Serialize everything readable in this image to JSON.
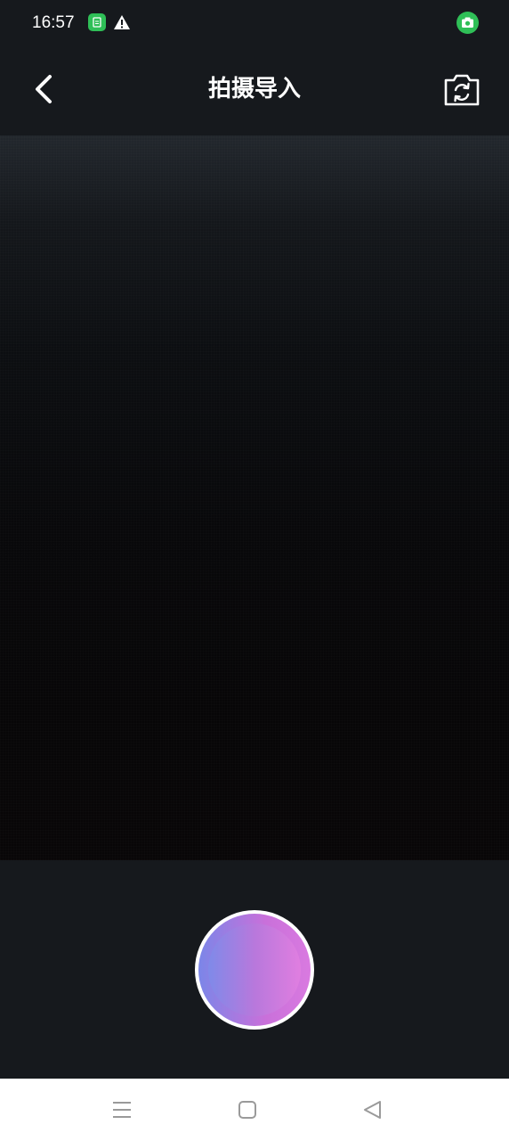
{
  "status_bar": {
    "time": "16:57",
    "icons": [
      "app-notification-icon",
      "warning-icon",
      "camera-in-use-icon"
    ]
  },
  "header": {
    "title": "拍摄导入",
    "back_icon": "chevron-left-icon",
    "switch_camera_icon": "switch-camera-icon"
  },
  "controls": {
    "shutter_icon": "shutter-icon"
  },
  "system_nav": {
    "icons": [
      "menu-icon",
      "home-icon",
      "back-triangle-icon"
    ]
  },
  "colors": {
    "background": "#16191d",
    "shutter_gradient_start": "#7b86e8",
    "shutter_gradient_end": "#d97ae0",
    "status_green": "#2fbf57",
    "nav_bar": "#ffffff"
  }
}
